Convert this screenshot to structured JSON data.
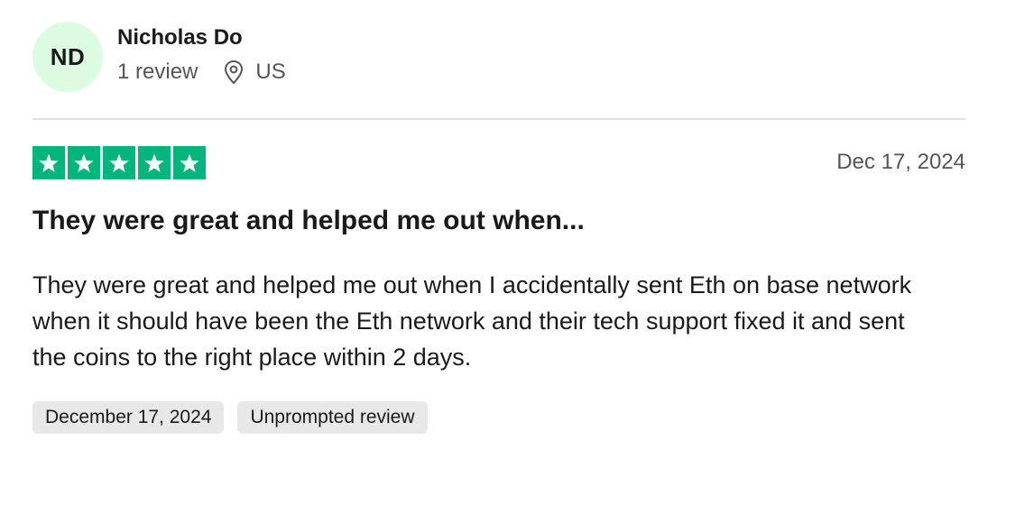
{
  "reviewer": {
    "initials": "ND",
    "name": "Nicholas Do",
    "review_count": "1 review",
    "country": "US",
    "avatar_color": "#dcfce2"
  },
  "review": {
    "rating": 5,
    "rating_max": 5,
    "star_color": "#00b67a",
    "date": "Dec 17, 2024",
    "title": "They were great and helped me out when...",
    "body": "They were great and helped me out when I accidentally sent Eth on base network when it should have been the Eth network and their tech support fixed it and sent the coins to the right place within 2 days.",
    "tags": [
      "December 17, 2024",
      "Unprompted review"
    ]
  },
  "icons": {
    "location": "location-pin-icon",
    "star": "star-icon"
  }
}
